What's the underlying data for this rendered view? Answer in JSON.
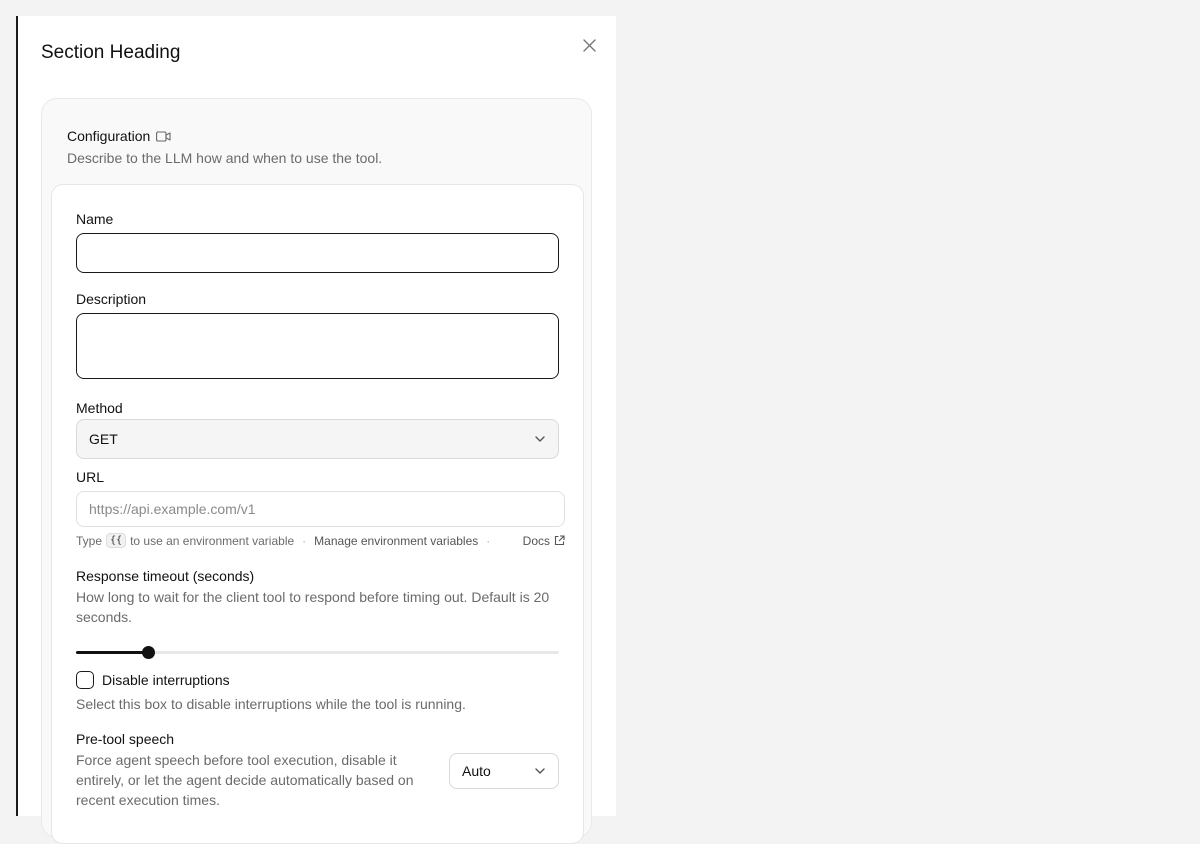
{
  "dialog": {
    "title": "Section Heading",
    "close_icon": "close-icon"
  },
  "config": {
    "title": "Configuration",
    "title_icon": "video-icon",
    "subtitle": "Describe to the LLM how and when to use the tool."
  },
  "form": {
    "name_label": "Name",
    "name_value": "",
    "description_label": "Description",
    "description_value": "",
    "method_label": "Method",
    "method_value": "GET",
    "url_label": "URL",
    "url_placeholder": "https://api.example.com/v1",
    "url_hint_prefix": "Type",
    "url_hint_code": "{{",
    "url_hint_suffix": "to use an environment variable",
    "manage_env_link": "Manage environment variables",
    "docs_link": "Docs",
    "timeout_label": "Response timeout (seconds)",
    "timeout_help": "How long to wait for the client tool to respond before timing out. Default is 20 seconds.",
    "timeout_slider_fraction": 0.15,
    "disable_interruptions_label": "Disable interruptions",
    "disable_interruptions_checked": false,
    "disable_interruptions_help": "Select this box to disable interruptions while the tool is running.",
    "pre_tool_label": "Pre-tool speech",
    "pre_tool_help": "Force agent speech before tool execution, disable it entirely, or let the agent decide automatically based on recent execution times.",
    "pre_tool_value": "Auto"
  },
  "colors": {
    "accent": "#111111",
    "muted_text": "#6b6b6b",
    "card_bg": "#f9f9f9"
  }
}
